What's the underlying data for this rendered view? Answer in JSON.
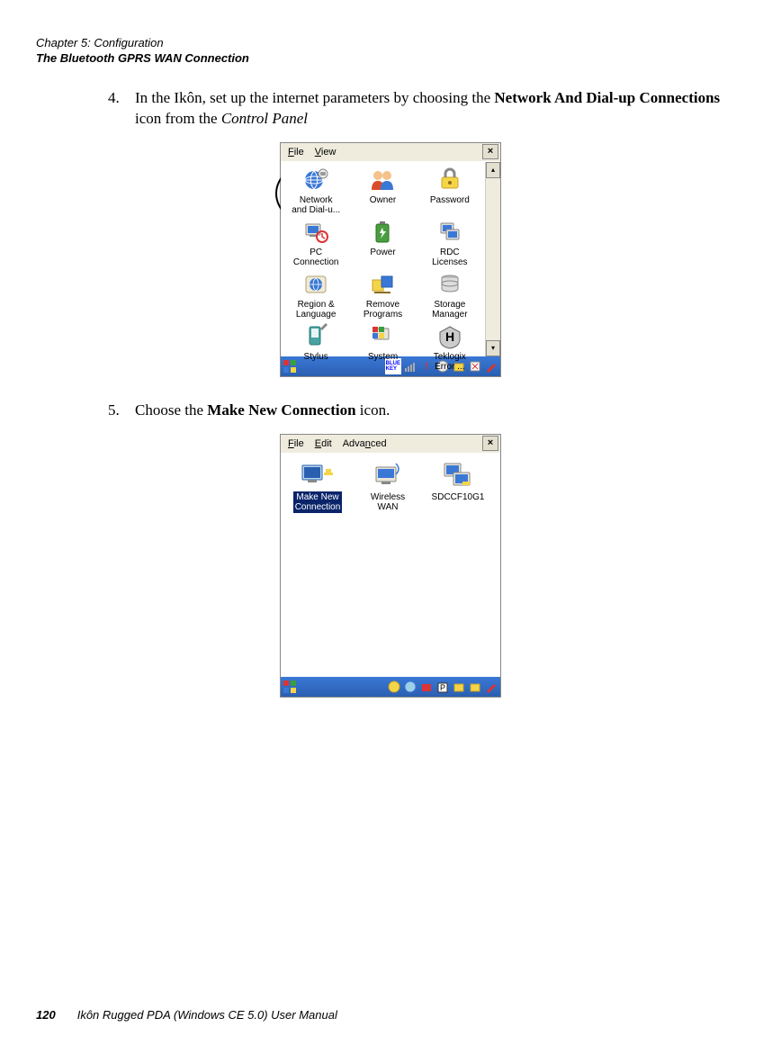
{
  "header": {
    "chapter": "Chapter 5:  Configuration",
    "section": "The Bluetooth GPRS WAN Connection"
  },
  "steps": {
    "s4": {
      "num": "4.",
      "t1": "In the Ikôn, set up the internet parameters by choosing the ",
      "bold1": "Network And Dial-up Connections",
      "t2": " icon from the ",
      "ital1": "Control Panel"
    },
    "s5": {
      "num": "5.",
      "t1": "Choose the ",
      "bold1": "Make New Connection",
      "t2": " icon."
    }
  },
  "cp": {
    "menu_file": "File",
    "menu_view": "View",
    "close": "×",
    "scroll_up": "▴",
    "scroll_down": "▾",
    "items": {
      "network": {
        "l1": "Network",
        "l2": "and Dial-u..."
      },
      "owner": "Owner",
      "password": "Password",
      "pcconn": {
        "l1": "PC",
        "l2": "Connection"
      },
      "power": "Power",
      "rdc": {
        "l1": "RDC",
        "l2": "Licenses"
      },
      "region": {
        "l1": "Region &",
        "l2": "Language"
      },
      "remove": {
        "l1": "Remove",
        "l2": "Programs"
      },
      "storage": {
        "l1": "Storage",
        "l2": "Manager"
      },
      "stylus": "Stylus",
      "system": "System",
      "teklogix": {
        "l1": "Teklogix",
        "l2": "Error ..."
      }
    },
    "bluekey": "BLUE KEY",
    "bang": "!"
  },
  "conn": {
    "menu_file": "File",
    "menu_edit": "Edit",
    "menu_adv": "Advanced",
    "close": "×",
    "items": {
      "makenew": {
        "l1": "Make New",
        "l2": "Connection"
      },
      "wwan": {
        "l1": "Wireless",
        "l2": "WAN"
      },
      "sdcc": "SDCCF10G1"
    }
  },
  "footer": {
    "page": "120",
    "title": "Ikôn Rugged PDA (Windows CE 5.0) User Manual"
  }
}
